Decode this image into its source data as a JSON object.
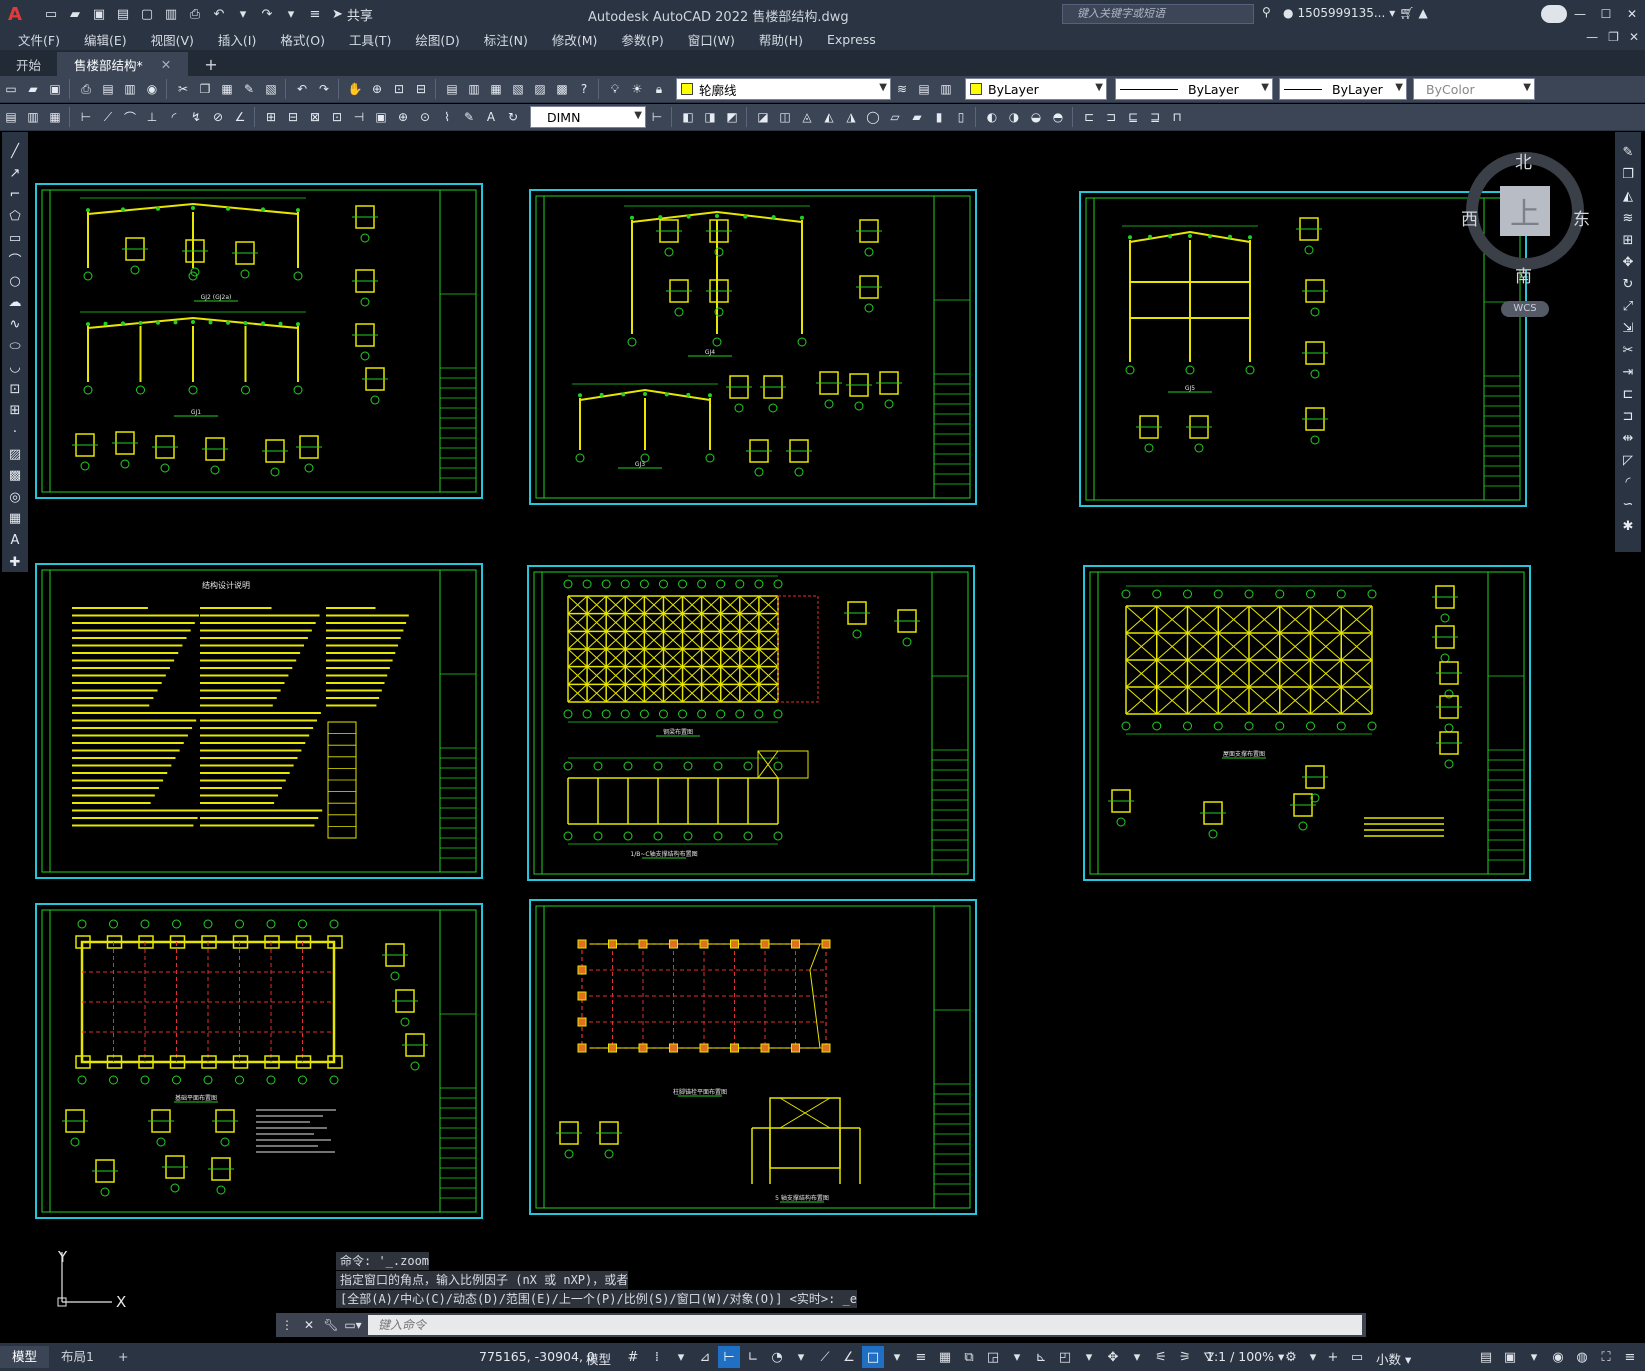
{
  "app": {
    "logo": "A",
    "title": "Autodesk AutoCAD 2022    售楼部结构.dwg",
    "share_label": "共享",
    "search_placeholder": "键入关键字或短语",
    "user": "1505999135...",
    "help": "?"
  },
  "menu": [
    "文件(F)",
    "编辑(E)",
    "视图(V)",
    "插入(I)",
    "格式(O)",
    "工具(T)",
    "绘图(D)",
    "标注(N)",
    "修改(M)",
    "参数(P)",
    "窗口(W)",
    "帮助(H)",
    "Express"
  ],
  "tabs": [
    {
      "label": "开始"
    },
    {
      "label": "售楼部结构*"
    }
  ],
  "tab_add": "+",
  "toolbar": {
    "layer": "轮廓线",
    "layer_color": "#ffff00",
    "color": "ByLayer",
    "linetype": "ByLayer",
    "lineweight": "ByLayer",
    "plotstyle": "ByColor",
    "dimstyle": "DIMN"
  },
  "viewcube": {
    "top": "上",
    "north": "北",
    "south": "南",
    "east": "东",
    "west": "西",
    "wcs": "WCS"
  },
  "ucs": {
    "x": "X",
    "y": "Y"
  },
  "sheets": [
    {
      "titles": [
        "GJ2 (GJ2a)",
        "GJ1"
      ]
    },
    {
      "titles": [
        "GJ4",
        "GJ3"
      ]
    },
    {
      "titles": [
        "GJ5"
      ]
    },
    {
      "titles": [
        "结构设计说明"
      ]
    },
    {
      "titles": [
        "钢梁布置图",
        "1/B~C轴支撑结构布置图"
      ]
    },
    {
      "titles": [
        "屋面支撑布置图"
      ]
    },
    {
      "titles": [
        "基础平面布置图"
      ]
    },
    {
      "titles": [
        "柱脚锚栓平面布置图",
        "5 轴支撑结构布置图"
      ]
    }
  ],
  "command": {
    "history": [
      "命令: '_.zoom",
      "指定窗口的角点，输入比例因子 (nX 或 nXP)，或者",
      "[全部(A)/中心(C)/动态(D)/范围(E)/上一个(P)/比例(S)/窗口(W)/对象(O)] <实时>: _e"
    ],
    "placeholder": "键入命令"
  },
  "status": {
    "layout_tabs": [
      "模型",
      "布局1"
    ],
    "add": "+",
    "coords": "775165, -30904, 0",
    "model": "模型",
    "scale": "1:1 / 100%",
    "units": "小数"
  }
}
